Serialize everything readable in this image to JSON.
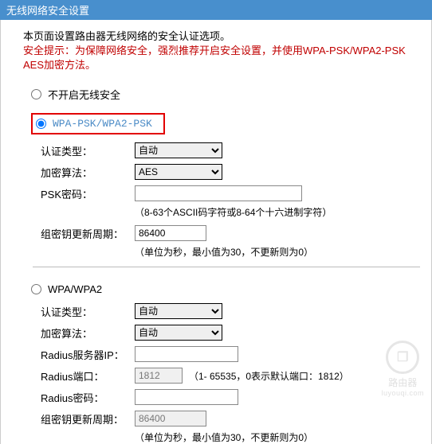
{
  "title": "无线网络安全设置",
  "desc": {
    "line1": "本页面设置路由器无线网络的安全认证选项。",
    "warn": "安全提示：为保障网络安全，强烈推荐开启安全设置，并使用WPA-PSK/WPA2-PSK AES加密方法。"
  },
  "options": {
    "none": "不开启无线安全",
    "psk": "WPA-PSK/WPA2-PSK",
    "wpa": "WPA/WPA2"
  },
  "psk": {
    "auth_label": "认证类型：",
    "auth_value": "自动",
    "enc_label": "加密算法：",
    "enc_value": "AES",
    "pwd_label": "PSK密码：",
    "pwd_value": "",
    "pwd_hint": "（8-63个ASCII码字符或8-64个十六进制字符）",
    "gk_label": "组密钥更新周期：",
    "gk_value": "86400",
    "gk_hint": "（单位为秒，最小值为30，不更新则为0）"
  },
  "wpa": {
    "auth_label": "认证类型：",
    "auth_value": "自动",
    "enc_label": "加密算法：",
    "enc_value": "自动",
    "radius_ip_label": "Radius服务器IP：",
    "radius_ip_value": "",
    "radius_port_label": "Radius端口：",
    "radius_port_value": "1812",
    "radius_port_hint": "（1- 65535，0表示默认端口：1812）",
    "radius_pwd_label": "Radius密码：",
    "radius_pwd_value": "",
    "gk_label": "组密钥更新周期：",
    "gk_value": "86400",
    "gk_hint": "（单位为秒，最小值为30，不更新则为0）"
  },
  "watermark": {
    "cn": "路由器",
    "en": "luyouqi.com"
  }
}
